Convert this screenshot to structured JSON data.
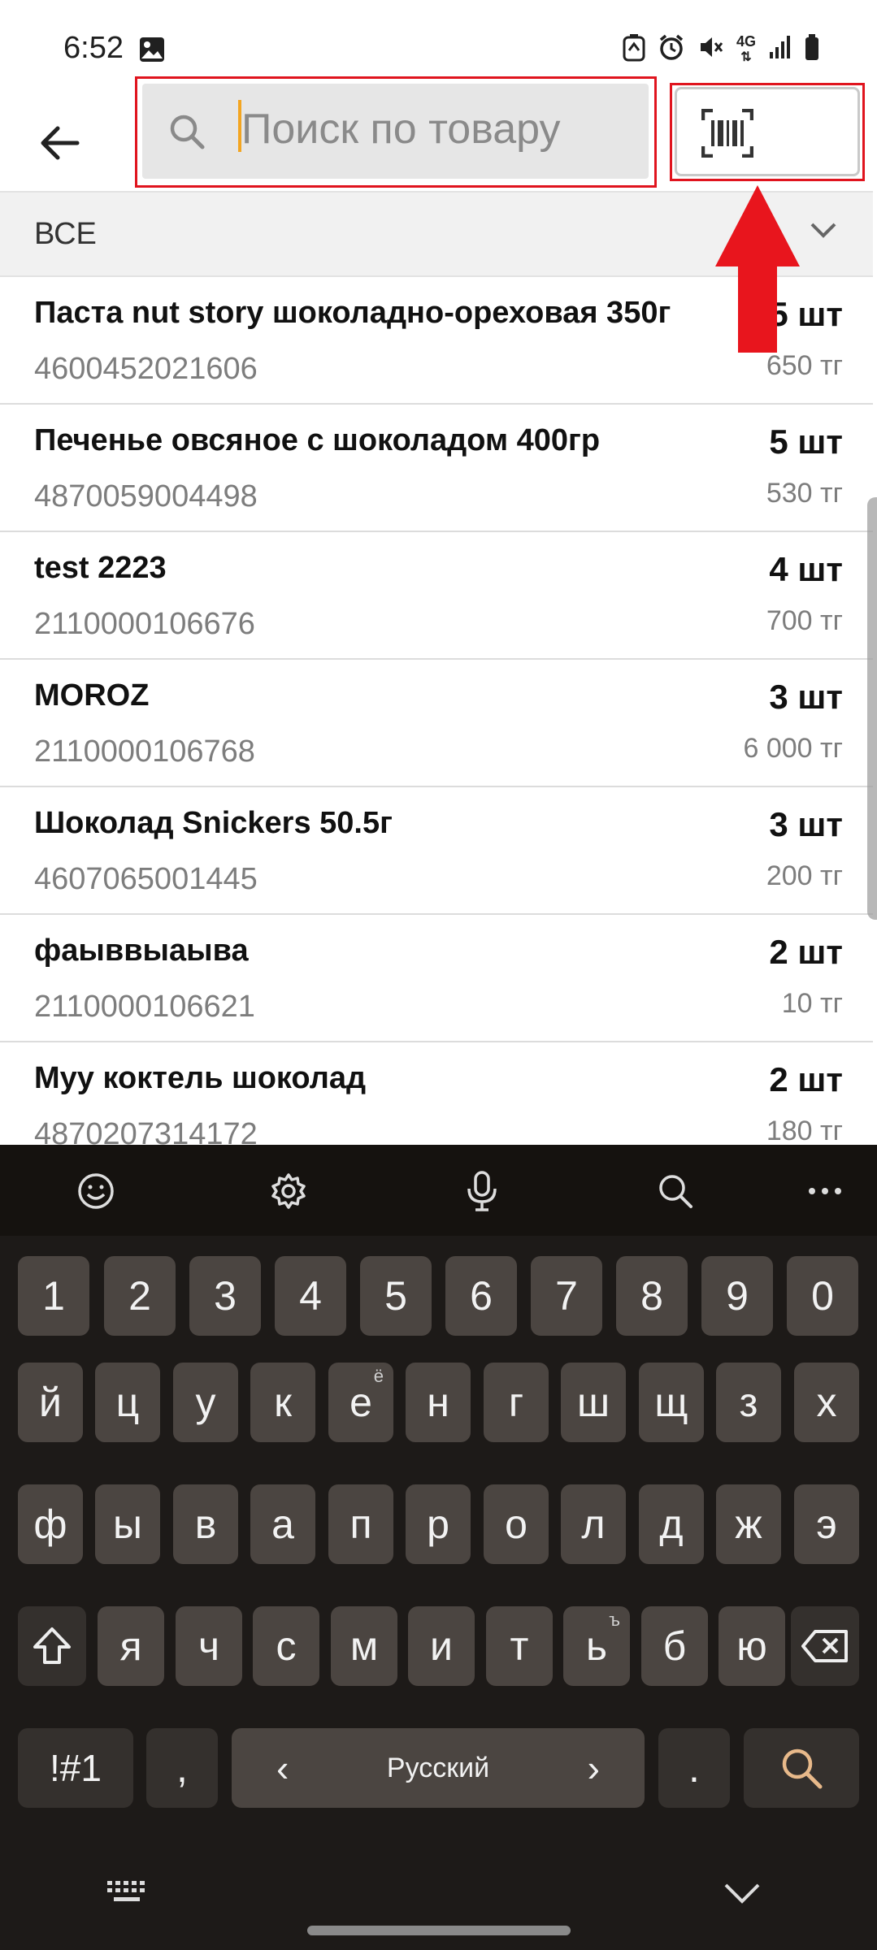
{
  "status_bar": {
    "time": "6:52",
    "network": "4G"
  },
  "header": {
    "search_placeholder": "Поиск по товару"
  },
  "filter": {
    "label": "ВСЕ"
  },
  "products": [
    {
      "name": "Паста nut story шоколадно-ореховая 350г",
      "code": "4600452021606",
      "qty": "5 шт",
      "price": "650 тг"
    },
    {
      "name": "Печенье овсяное с шоколадом 400гр",
      "code": "4870059004498",
      "qty": "5 шт",
      "price": "530 тг"
    },
    {
      "name": "test 2223",
      "code": "2110000106676",
      "qty": "4 шт",
      "price": "700 тг"
    },
    {
      "name": "MOROZ",
      "code": "2110000106768",
      "qty": "3 шт",
      "price": "6 000 тг"
    },
    {
      "name": "Шоколад Snickers 50.5г",
      "code": "4607065001445",
      "qty": "3 шт",
      "price": "200 тг"
    },
    {
      "name": "фаыввыаыва",
      "code": "2110000106621",
      "qty": "2 шт",
      "price": "10 тг"
    },
    {
      "name": "Муу коктель шоколад",
      "code": "4870207314172",
      "qty": "2 шт",
      "price": "180 тг"
    }
  ],
  "keyboard": {
    "row_numbers": [
      "1",
      "2",
      "3",
      "4",
      "5",
      "6",
      "7",
      "8",
      "9",
      "0"
    ],
    "row1": [
      "й",
      "ц",
      "у",
      "к",
      "е",
      "н",
      "г",
      "ш",
      "щ",
      "з",
      "х"
    ],
    "row1_hint_e": "ё",
    "row2": [
      "ф",
      "ы",
      "в",
      "а",
      "п",
      "р",
      "о",
      "л",
      "д",
      "ж",
      "э"
    ],
    "row3": [
      "я",
      "ч",
      "с",
      "м",
      "и",
      "т",
      "ь",
      "б",
      "ю"
    ],
    "row3_hint_soft": "ъ",
    "symbols_label": "!#1",
    "comma": ",",
    "space_label": "Русский",
    "space_left": "‹",
    "space_right": "›",
    "period": "."
  },
  "colors": {
    "highlight": "#e0141e",
    "caret": "#f3a521",
    "keyboard_bg": "#1d1a18",
    "key_bg": "#4b4541"
  }
}
